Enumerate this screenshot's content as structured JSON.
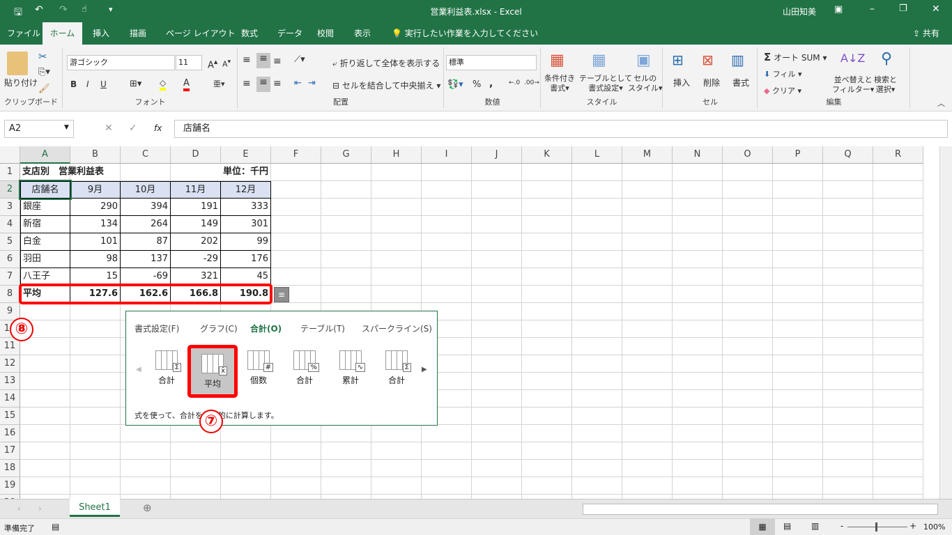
{
  "titlebar": {
    "title": "営業利益表.xlsx  -  Excel",
    "user": "山田知美",
    "qat_icons": [
      "save-icon",
      "undo-icon",
      "redo-icon",
      "touch-mode-icon",
      "customize-icon"
    ]
  },
  "tabs": [
    {
      "label": "ファイル"
    },
    {
      "label": "ホーム",
      "active": true
    },
    {
      "label": "挿入"
    },
    {
      "label": "描画"
    },
    {
      "label": "ページ レイアウト"
    },
    {
      "label": "数式"
    },
    {
      "label": "データ"
    },
    {
      "label": "校閲"
    },
    {
      "label": "表示"
    }
  ],
  "tell_me": "実行したい作業を入力してください",
  "share": "共有",
  "ribbon": {
    "clipboard": {
      "label": "クリップボード",
      "paste": "貼り付け"
    },
    "font": {
      "label": "フォント",
      "font_name": "游ゴシック",
      "font_size": "11",
      "bold": "B",
      "italic": "I",
      "underline": "U",
      "fill_color": "#ffff00",
      "font_color": "#ff0000"
    },
    "alignment": {
      "label": "配置",
      "wrap": "折り返して全体を表示する",
      "merge": "セルを結合して中央揃え"
    },
    "number": {
      "label": "数値",
      "format": "標準",
      "percent": "%",
      "comma": ","
    },
    "styles": {
      "label": "スタイル",
      "conditional": [
        "条件付き",
        "書式"
      ],
      "table": [
        "テーブルとして",
        "書式設定"
      ],
      "cell_styles": [
        "セルの",
        "スタイル"
      ]
    },
    "cells": {
      "label": "セル",
      "insert": "挿入",
      "delete": "削除",
      "format": "書式"
    },
    "editing": {
      "label": "編集",
      "autosum": "オート SUM",
      "fill": "フィル",
      "clear": "クリア",
      "sort": [
        "並べ替えと",
        "フィルター"
      ],
      "find": [
        "検索と",
        "選択"
      ]
    }
  },
  "formula_bar": {
    "name_box": "A2",
    "fx": "fx",
    "content": "店舗名"
  },
  "columns": [
    "A",
    "B",
    "C",
    "D",
    "E",
    "F",
    "G",
    "H",
    "I",
    "J",
    "K",
    "L",
    "M",
    "N",
    "O",
    "P",
    "Q",
    "R"
  ],
  "rows": [
    [
      "支店別　営業利益表",
      "",
      "",
      "単位：千円",
      ""
    ],
    [
      "店舗名",
      "9月",
      "10月",
      "11月",
      "12月"
    ],
    [
      "銀座",
      "290",
      "394",
      "191",
      "333"
    ],
    [
      "新宿",
      "134",
      "264",
      "149",
      "301"
    ],
    [
      "白金",
      "101",
      "87",
      "202",
      "99"
    ],
    [
      "羽田",
      "98",
      "137",
      "-29",
      "176"
    ],
    [
      "八王子",
      "15",
      "-69",
      "321",
      "45"
    ],
    [
      "平均",
      "127.6",
      "162.6",
      "166.8",
      "190.8"
    ],
    [],
    [],
    [],
    [],
    [],
    [],
    [],
    [],
    [],
    [],
    [],
    []
  ],
  "quick_analysis": {
    "tabs": [
      "書式設定(F)",
      "グラフ(C)",
      "合計(O)",
      "テーブル(T)",
      "スパークライン(S)"
    ],
    "active_tab": 2,
    "items": [
      {
        "label": "合計",
        "icon": "sum-row-icon",
        "sym": "Σ"
      },
      {
        "label": "平均",
        "icon": "average-icon",
        "sym": "x̄",
        "selected": true
      },
      {
        "label": "個数",
        "icon": "count-icon",
        "sym": "#"
      },
      {
        "label": "合計",
        "icon": "percent-total-icon",
        "sym": "%"
      },
      {
        "label": "累計",
        "icon": "running-total-icon",
        "sym": "∿"
      },
      {
        "label": "合計",
        "icon": "sum-column-icon",
        "sym": "Σ"
      }
    ],
    "description": "式を使って、合計を自動的に計算します。"
  },
  "annotations": {
    "step7": "⑦",
    "step8": "⑧",
    "highlight_color": "#ff0000"
  },
  "sheets": [
    {
      "label": "Sheet1",
      "active": true
    }
  ],
  "status": {
    "ready": "準備完了",
    "zoom": "100%"
  },
  "colors": {
    "excel_green": "#217346",
    "header_fill": "#d9e1f2"
  }
}
